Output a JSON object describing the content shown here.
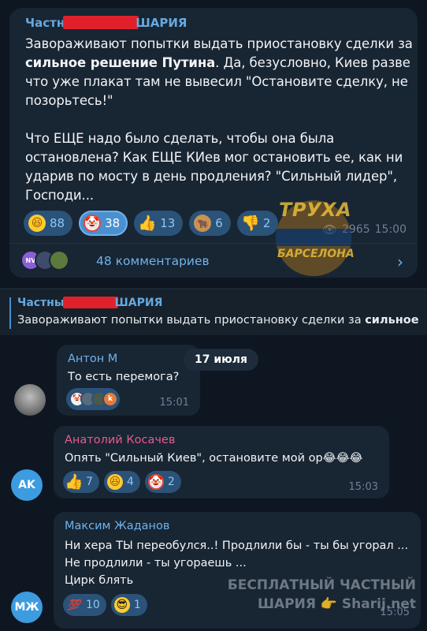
{
  "post": {
    "author_pre": "Частн",
    "author_post": "ШАРИЯ",
    "para1_a": "Завораживают попытки выдать приостановку сделки за ",
    "para1_bold": "сильное решение Путина",
    "para1_b": ". Да, безусловно, Киев разве что уже плакат там не вывесил \"Остановите сделку, не позорьтесь!\"",
    "para2": "Что ЕЩЕ надо было сделать, чтобы она была остановлена? Как ЕЩЕ КИев мог остановить ее, как ни ударив по мосту в день продления? \"Сильный лидер\", Господи...",
    "reactions": [
      {
        "icon": "laugh-emoji-icon",
        "count": "88"
      },
      {
        "icon": "clown-emoji-icon",
        "count": "38"
      },
      {
        "icon": "thumbs-up-icon",
        "count": "13"
      },
      {
        "icon": "bull-emoji-icon",
        "count": "6"
      },
      {
        "icon": "thumbs-down-icon",
        "count": "2"
      }
    ],
    "views": "2965",
    "time": "15:00",
    "comments_label": "48 комментариев",
    "avatar_nv": "NV"
  },
  "watermark": {
    "logo_top": "ТРУХА",
    "logo_bottom": "БАРСЕЛОНА",
    "line1": "БЕСПЛАТНЫЙ ЧАСТНЫЙ",
    "line2": "ШАРИЯ 👉 Sharij.net"
  },
  "chat": {
    "pinned_author_pre": "Частны",
    "pinned_author_post": "ШАРИЯ",
    "pinned_text_a": "Завораживают попытки выдать приостановку сделки за ",
    "pinned_text_bold": "сильное ...",
    "date": "17 июля",
    "messages": [
      {
        "name": "Антон М",
        "name_color": "#6fb3ec",
        "text": "То есть перемога?",
        "time": "15:01",
        "reaction_stack": [
          "🤡",
          "",
          "",
          "k"
        ]
      },
      {
        "name": "Анатолий Косачев",
        "name_color": "#e85a8e",
        "text": "Опять \"Сильный Киев\", остановите мой ор😂😂😂",
        "time": "15:03",
        "avatar": "AK",
        "reactions": [
          {
            "icon": "thumbs-up-icon",
            "count": "7"
          },
          {
            "icon": "laugh-emoji-icon",
            "count": "4"
          },
          {
            "icon": "clown-emoji-icon",
            "count": "2"
          }
        ]
      },
      {
        "name": "Максим Жаданов",
        "name_color": "#6fb3ec",
        "line1": "Ни хера ТЫ переобулся..! Продлили бы - ты бы угорал ...",
        "line2": "Не продлили - ты угораешь ...",
        "line3": "Цирк блять",
        "time": "15:05",
        "avatar": "МЖ",
        "reactions": [
          {
            "icon": "hundred-emoji-icon",
            "count": "10"
          },
          {
            "icon": "cool-emoji-icon",
            "count": "1"
          }
        ]
      }
    ]
  }
}
